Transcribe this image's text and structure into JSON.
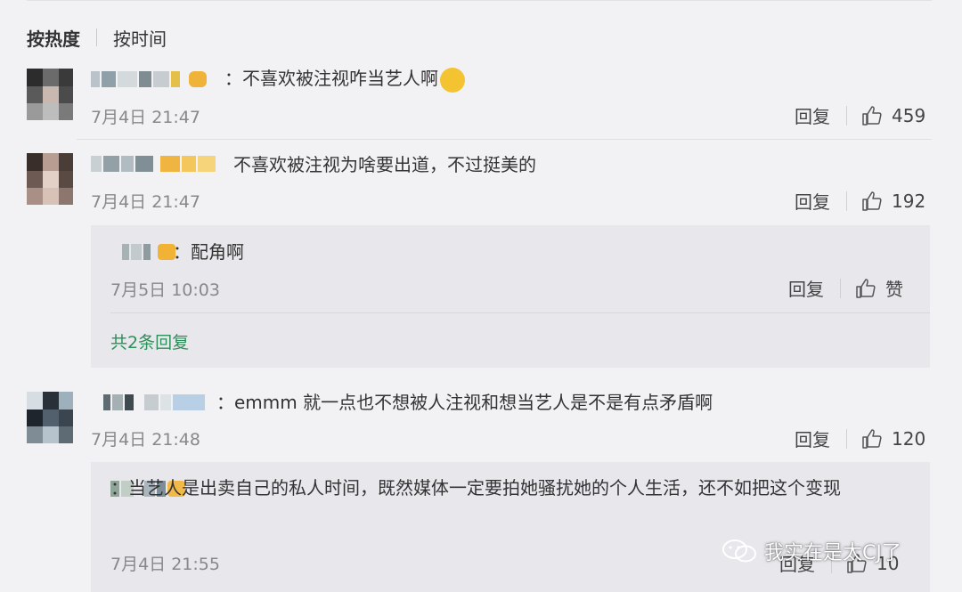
{
  "sort": {
    "hot": "按热度",
    "time": "按时间"
  },
  "colors": {
    "accent_green": "#2d8f5a",
    "timestamp_gray": "#888888",
    "reply_bg": "#e8e8ec"
  },
  "comments": [
    {
      "content": "：不喜欢被注视咋当艺人啊",
      "time": "7月4日 21:47",
      "reply_label": "回复",
      "likes": "459"
    },
    {
      "content": "不喜欢被注视为啥要出道，不过挺美的",
      "time": "7月4日 21:47",
      "reply_label": "回复",
      "likes": "192",
      "replies": [
        {
          "content": "：配角啊",
          "time": "7月5日 10:03",
          "reply_label": "回复",
          "like_label": "赞"
        }
      ],
      "more_replies": "共2条回复"
    },
    {
      "content": "：emmm 就一点也不想被人注视和想当艺人是不是有点矛盾啊",
      "time": "7月4日 21:48",
      "reply_label": "回复",
      "likes": "120",
      "replies": [
        {
          "content": "：当艺人是出卖自己的私人时间，既然媒体一定要拍她骚扰她的个人生活，还不如把这个变现",
          "time": "7月4日 21:55",
          "reply_label": "回复",
          "likes": "10"
        }
      ]
    }
  ],
  "watermark": {
    "text": "我实在是太CJ了",
    "icon": "wechat-icon"
  }
}
